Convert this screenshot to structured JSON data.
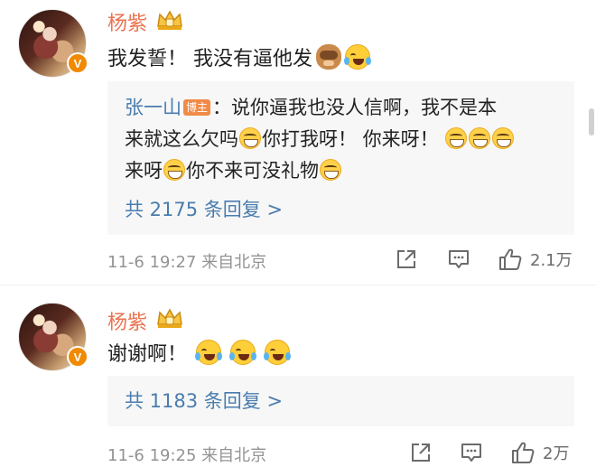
{
  "comments": [
    {
      "username": "杨紫",
      "text": "我发誓！ 我没有逼他发",
      "reply": {
        "user": "张一山",
        "badge": "博主",
        "line1": "：说你逼我也没人信啊，我不是本",
        "line2a": "来就这么欠吗",
        "line2b": "你打我呀！ 你来呀！ ",
        "line3a": "来呀",
        "line3b": "你不来可没礼物"
      },
      "more_replies": "共 2175 条回复 >",
      "timestamp": "11-6 19:27  来自北京",
      "like_count": "2.1万"
    },
    {
      "username": "杨紫",
      "text": "谢谢啊！",
      "more_replies": "共 1183 条回复 >",
      "timestamp": "11-6 19:25  来自北京",
      "like_count": "2万"
    }
  ],
  "icons": {
    "verified": "verified-v-icon",
    "crown": "vip-crown-icon",
    "share": "share-icon",
    "comment": "comment-icon",
    "like": "like-thumb-icon"
  },
  "colors": {
    "username": "#eb7350",
    "link": "#4a7dad",
    "meta": "#939393",
    "reply_bg": "#f7f7f7",
    "verified": "#f08a00"
  }
}
